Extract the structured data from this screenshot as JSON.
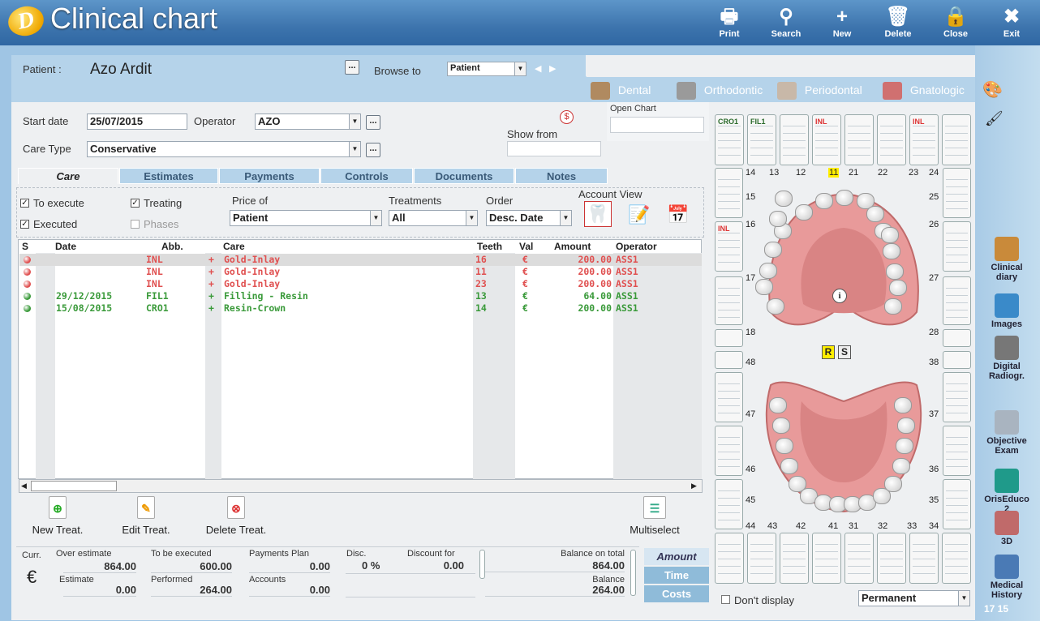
{
  "app": {
    "title": "Clinical chart",
    "logo_letter": "D"
  },
  "toolbar": [
    {
      "label": "Print",
      "icon": "printer-icon",
      "glyph": "🖶"
    },
    {
      "label": "Search",
      "icon": "search-icon",
      "glyph": "⚲"
    },
    {
      "label": "New",
      "icon": "new-icon",
      "glyph": "+"
    },
    {
      "label": "Delete",
      "icon": "trash-icon",
      "glyph": "🗑"
    },
    {
      "label": "Close",
      "icon": "lock-icon",
      "glyph": "🔒"
    },
    {
      "label": "Exit",
      "icon": "close-icon",
      "glyph": "✖"
    }
  ],
  "patient": {
    "label": "Patient :",
    "name": "Azo Ardit",
    "browse_label": "Browse to",
    "browse_value": "Patient"
  },
  "dental_tabs": [
    {
      "label": "Dental",
      "icon": "dental-icon"
    },
    {
      "label": "Orthodontic",
      "icon": "orthodontic-icon"
    },
    {
      "label": "Periodontal",
      "icon": "periodontal-icon"
    },
    {
      "label": "Gnatologic",
      "icon": "gnatologic-icon"
    }
  ],
  "form": {
    "start_date_label": "Start date",
    "start_date": "25/07/2015",
    "operator_label": "Operator",
    "operator": "AZO",
    "care_type_label": "Care Type",
    "care_type": "Conservative",
    "show_from_label": "Show from",
    "open_chart_label": "Open Chart",
    "dollar": "$"
  },
  "content_tabs": [
    "Care",
    "Estimates",
    "Payments",
    "Controls",
    "Documents",
    "Notes"
  ],
  "filters": {
    "to_execute": "To execute",
    "executed": "Executed",
    "treating": "Treating",
    "phases": "Phases",
    "check": "✓",
    "price_of_label": "Price of",
    "price_of": "Patient",
    "treatments_label": "Treatments",
    "treatments": "All",
    "order_label": "Order",
    "order": "Desc. Date",
    "account_view_label": "Account View"
  },
  "grid": {
    "headers": {
      "s": "S",
      "date": "Date",
      "abb": "Abb.",
      "care": "Care",
      "teeth": "Teeth",
      "val": "Val",
      "amount": "Amount",
      "operator": "Operator"
    },
    "rows": [
      {
        "status": "red",
        "date": "",
        "abb": "INL",
        "plus": "+",
        "care": "Gold-Inlay",
        "teeth": "16",
        "val": "€",
        "amount": "200.00",
        "operator": "ASS1"
      },
      {
        "status": "red",
        "date": "",
        "abb": "INL",
        "plus": "+",
        "care": "Gold-Inlay",
        "teeth": "11",
        "val": "€",
        "amount": "200.00",
        "operator": "ASS1"
      },
      {
        "status": "red",
        "date": "",
        "abb": "INL",
        "plus": "+",
        "care": "Gold-Inlay",
        "teeth": "23",
        "val": "€",
        "amount": "200.00",
        "operator": "ASS1"
      },
      {
        "status": "green",
        "date": "29/12/2015",
        "abb": "FIL1",
        "plus": "+",
        "care": "Filling - Resin",
        "teeth": "13",
        "val": "€",
        "amount": "64.00",
        "operator": "ASS1"
      },
      {
        "status": "green",
        "date": "15/08/2015",
        "abb": "CRO1",
        "plus": "+",
        "care": "Resin-Crown",
        "teeth": "14",
        "val": "€",
        "amount": "200.00",
        "operator": "ASS1"
      }
    ]
  },
  "actions": {
    "new": "New Treat.",
    "edit": "Edit Treat.",
    "delete": "Delete Treat.",
    "multiselect": "Multiselect"
  },
  "footer": {
    "curr_label": "Curr.",
    "currency": "€",
    "over_estimate_label": "Over estimate",
    "over_estimate": "864.00",
    "estimate_label": "Estimate",
    "estimate": "0.00",
    "to_be_executed_label": "To be executed",
    "to_be_executed": "600.00",
    "performed_label": "Performed",
    "performed": "264.00",
    "payments_plan_label": "Payments Plan",
    "payments_plan": "0.00",
    "accounts_label": "Accounts",
    "accounts": "0.00",
    "disc_label": "Disc.",
    "disc": "0 %",
    "discount_for_label": "Discount for",
    "discount_for": "0.00",
    "balance_total_label": "Balance on total",
    "balance_total": "864.00",
    "balance_label": "Balance",
    "balance": "264.00",
    "switch": [
      "Amount",
      "Time",
      "Costs"
    ]
  },
  "chart": {
    "upper_labels": [
      "CRO1",
      "FIL1",
      "",
      "INL",
      "",
      "",
      "INL",
      ""
    ],
    "left_side_label": "INL",
    "upper_numbers": [
      "14",
      "13",
      "12",
      "11",
      "21",
      "22",
      "23",
      "24"
    ],
    "left_upper_numbers": [
      "15",
      "16",
      "17",
      "18"
    ],
    "right_upper_numbers": [
      "25",
      "26",
      "27",
      "28"
    ],
    "left_lower_numbers": [
      "48",
      "47",
      "46",
      "45"
    ],
    "right_lower_numbers": [
      "38",
      "37",
      "36",
      "35"
    ],
    "lower_numbers": [
      "44",
      "43",
      "42",
      "41",
      "31",
      "32",
      "33",
      "34"
    ],
    "r_label": "R",
    "s_label": "S",
    "info": "i",
    "dont_display": "Don't display",
    "dentition": "Permanent",
    "counts": "17  15"
  },
  "sidebar": [
    {
      "label": "Clinical diary",
      "icon": "book-icon",
      "color": "#c98a3a"
    },
    {
      "label": "Images",
      "icon": "images-icon",
      "color": "#3a8ac9"
    },
    {
      "label": "Digital Radiogr.",
      "icon": "xray-icon",
      "color": "#777777"
    },
    {
      "label": "Objective Exam",
      "icon": "tooth-icon",
      "color": "#a9b4c0"
    },
    {
      "label": "OrisEduco 2",
      "icon": "oriseduco-icon",
      "color": "#1f9a8a"
    },
    {
      "label": "3D",
      "icon": "3d-jaw-icon",
      "color": "#c06a6a"
    },
    {
      "label": "Medical History",
      "icon": "medical-history-icon",
      "color": "#4a7ab5"
    }
  ],
  "colors": {
    "red_row": "#e05050",
    "green_row": "#3a9a3a",
    "accent": "#3d74ad"
  }
}
